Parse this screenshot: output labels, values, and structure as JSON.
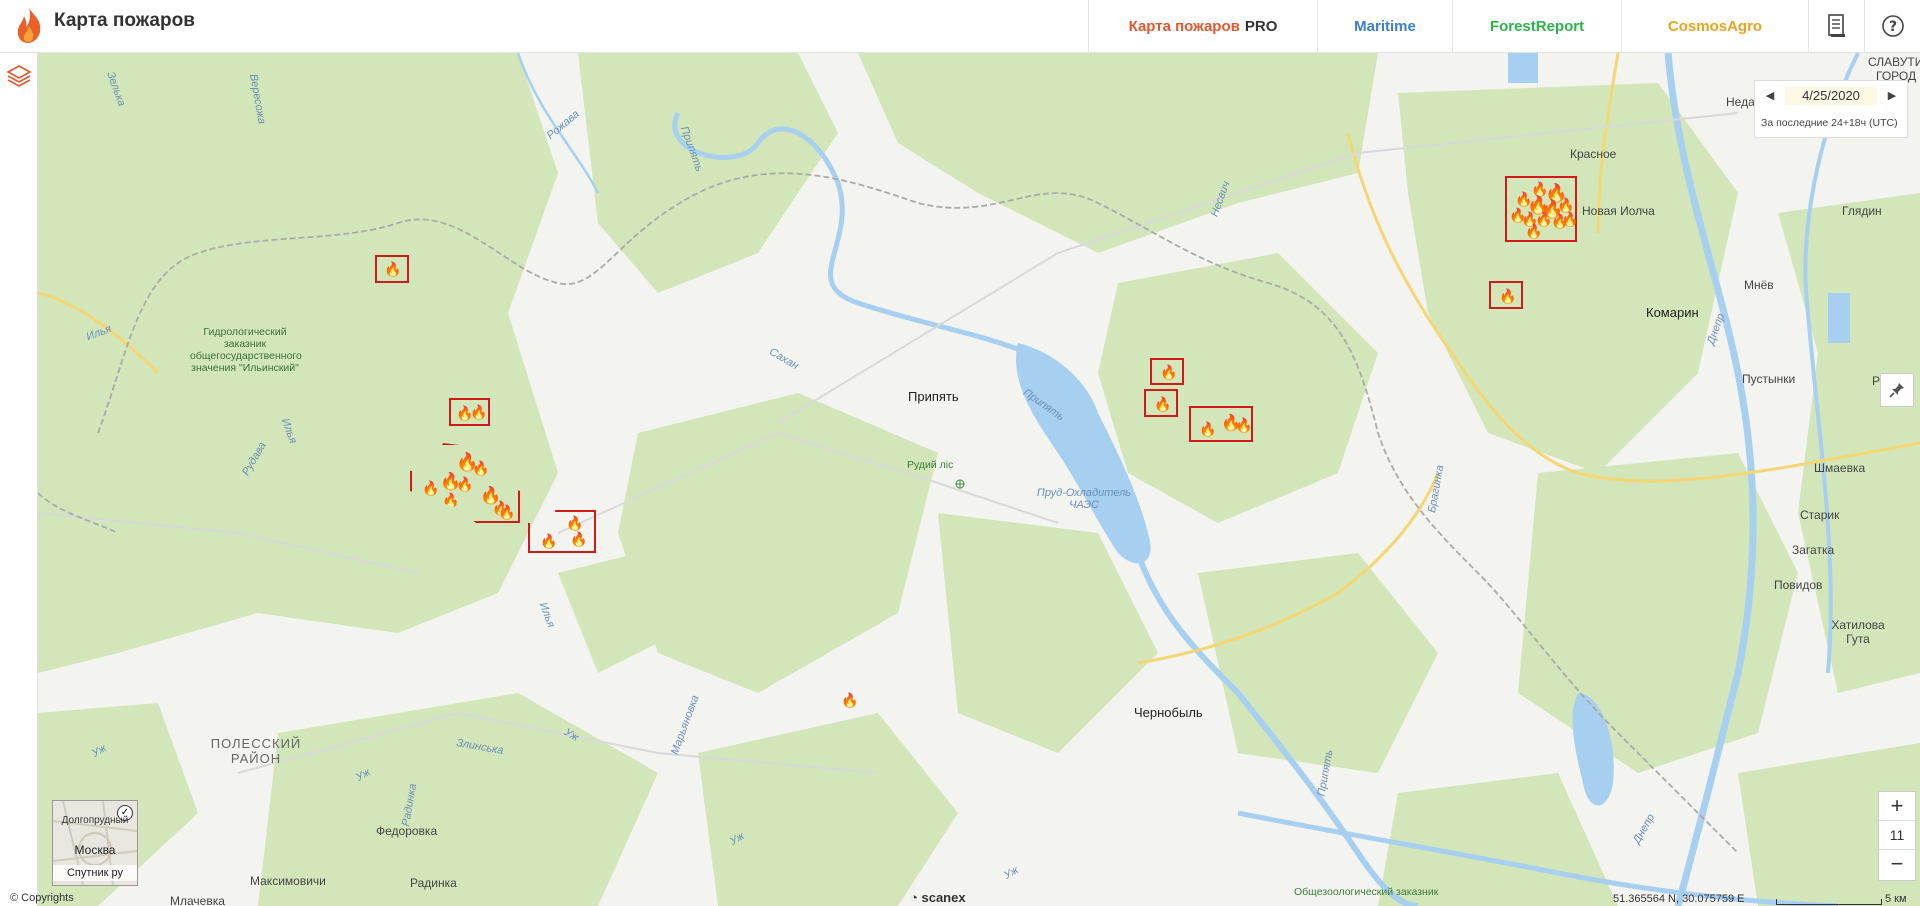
{
  "app": {
    "title": "Карта пожаров"
  },
  "nav": [
    {
      "name": "nav-fires-pro",
      "label": "Карта пожаров",
      "suffix": "PRO",
      "color": "#e4572e",
      "width": 228
    },
    {
      "name": "nav-maritime",
      "label": "Maritime",
      "color": "#3b7fd1",
      "width": 134
    },
    {
      "name": "nav-forestreport",
      "label": "ForestReport",
      "color": "#2db34a",
      "width": 168
    },
    {
      "name": "nav-cosmosagro",
      "label": "CosmosAgro",
      "color": "#e5a422",
      "width": 186
    }
  ],
  "nav_icons": [
    "document-icon",
    "help-icon"
  ],
  "date_panel": {
    "date": "4/25/2020",
    "period": "За последние 24+18ч (UTC)"
  },
  "zoom": {
    "plus": "+",
    "minus": "−",
    "level": "11"
  },
  "minimap": {
    "city": "Москва",
    "label": "Спутник ру",
    "top_label": "Долгопрудный"
  },
  "footer": {
    "copyrights": "© Copyrights",
    "brand": "scanex",
    "coords": "51.365564 N, 30.075759 E",
    "scale": "5 км"
  },
  "labels": {
    "pripyat": "Припять",
    "chernobyl": "Чернобыль",
    "komarin": "Комарин",
    "krasnoe": "Красное",
    "novaya_iolcha": "Новая Иолча",
    "glyadin": "Глядин",
    "mnev": "Мнёв",
    "pustynki": "Пустынки",
    "shmaevka": "Шмаевка",
    "starik": "Старик",
    "zagatka": "Загатка",
    "povidov": "Повидов",
    "khatilova_guta": "Хатилова Гута",
    "ned": "Неда",
    "slavutich": "СЛАВУТИЧ",
    "gorod": "ГОРОД",
    "rud": "Рудн",
    "fedorovka": "Федоровка",
    "maksimovichi": "Максимовичи",
    "radinka": "Радинка",
    "mlachevka": "Млачевка",
    "polessky": "ПОЛЕССКИЙ РАЙОН",
    "rudiy_lis": "Рудий ліс",
    "prud": "Пруд-Охладитель ЧАЭС",
    "reserve": "Гидрологический заказник общегосударственного значения \"Ильинский\"",
    "obsh_zakaznik": "Общезоологический заказник",
    "r_ilya1": "Илья",
    "r_ilya2": "Илья",
    "r_ilya3": "Илья",
    "r_rudava": "Рудава",
    "r_saxan": "Сахан",
    "r_pripyat1": "Припять",
    "r_pripyat2": "Припять",
    "r_pripyat3": "Припять",
    "r_zelyka": "Зелька",
    "r_veresozha": "Вересожа",
    "r_rozhava": "Рожава",
    "r_nesvich": "Несвич",
    "r_braginka": "Брагинка",
    "r_dnepr1": "Днепр",
    "r_dnepr2": "Днепр",
    "r_maryanovka": "Марьяновка",
    "r_zlinska": "Злинська",
    "r_uzh1": "Уж",
    "r_uzh2": "Уж",
    "r_uzh3": "Уж",
    "r_uzh4": "Уж",
    "r_uzh5": "Уж",
    "r_radynka": "Радинка"
  },
  "colors": {
    "fire_outline": "#d11a1a",
    "forest": "#d2e6b9",
    "water": "#a7cfef",
    "road": "#f4d774",
    "border": "#999999"
  },
  "fires": [
    {
      "name": "fire-a",
      "flames": 1
    },
    {
      "name": "fire-b",
      "flames": 2
    },
    {
      "name": "fire-c",
      "flames": 9
    },
    {
      "name": "fire-d",
      "flames": 3
    },
    {
      "name": "fire-e",
      "flames": 1
    },
    {
      "name": "fire-f",
      "flames": 1
    },
    {
      "name": "fire-g",
      "flames": 1
    },
    {
      "name": "fire-h",
      "flames": 3
    },
    {
      "name": "fire-i",
      "flames": 12
    },
    {
      "name": "fire-j",
      "flames": 1
    }
  ]
}
